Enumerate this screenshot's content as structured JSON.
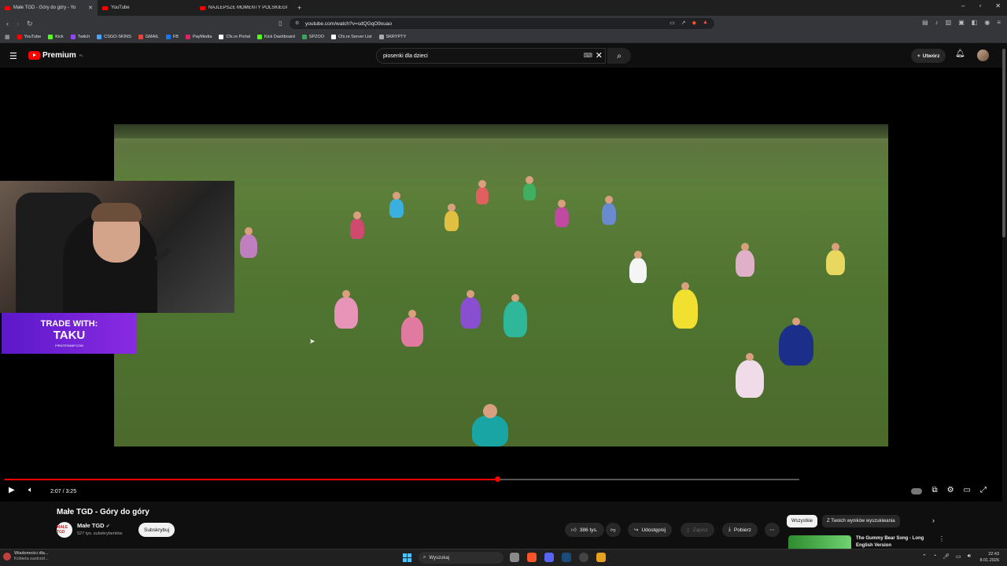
{
  "browser": {
    "tabs": [
      {
        "label": "Małe TGD - Góry do góry - Yo",
        "active": true
      },
      {
        "label": "YouTube",
        "active": false
      },
      {
        "label": "NAJLEPSZE MOMENTY POLSKIEGO",
        "active": false
      }
    ],
    "new_tab": "+",
    "url": "youtube.com/watch?v=sdQGqO9xuao",
    "bookmarks": [
      {
        "label": "YouTube",
        "color": "#ff0000"
      },
      {
        "label": "Kick",
        "color": "#53fc18"
      },
      {
        "label": "Twitch",
        "color": "#9146ff"
      },
      {
        "label": "CSGO-SKINS",
        "color": "#4aa3ff"
      },
      {
        "label": "GMAIL",
        "color": "#ea4335"
      },
      {
        "label": "FB",
        "color": "#1877f2"
      },
      {
        "label": "PayMedia",
        "color": "#e0245e"
      },
      {
        "label": "Cfx.re Portal",
        "color": "#ffffff"
      },
      {
        "label": "Kick Dashboard",
        "color": "#53fc18"
      },
      {
        "label": "SPZOO",
        "color": "#3ba55d"
      },
      {
        "label": "Cfx.re Server List",
        "color": "#ffffff"
      },
      {
        "label": "SKRYPTY",
        "color": "#aaaaaa"
      }
    ]
  },
  "youtube": {
    "brand": "Premium",
    "brand_sup": "PL",
    "search_value": "piosenki dla dzieci",
    "create_label": "Utwórz"
  },
  "overlay": {
    "sponsor_line1": "TRADE WITH:",
    "sponsor_line2": "TAKU",
    "sponsor_line3": "PIRATESWAP.COM"
  },
  "player": {
    "time": "2:07 / 3:25",
    "progress": 0.62,
    "buffered": 1.0
  },
  "video": {
    "title": "Małe TGD - Góry do góry",
    "channel": "Małe TGD",
    "channel_avatar_text": "MAŁE TGD",
    "subscribers": "527 tys. subskrybentów",
    "subscribe_label": "Subskrybuj",
    "likes": "386 tys.",
    "share_label": "Udostępnij",
    "save_label": "Zapisz",
    "download_label": "Pobierz"
  },
  "sidebar": {
    "chips": [
      "Wszystkie",
      "Z Twoich wyników wyszukiwania"
    ],
    "rec_title": "The Gummy Bear Song - Long English Version"
  },
  "taskbar": {
    "notif_line1": "Wiadomości dla...",
    "notif_line2": "Kobieta zastrzel...",
    "search": "Wyszukaj",
    "time": "22:43",
    "date": "8.01.2026"
  }
}
